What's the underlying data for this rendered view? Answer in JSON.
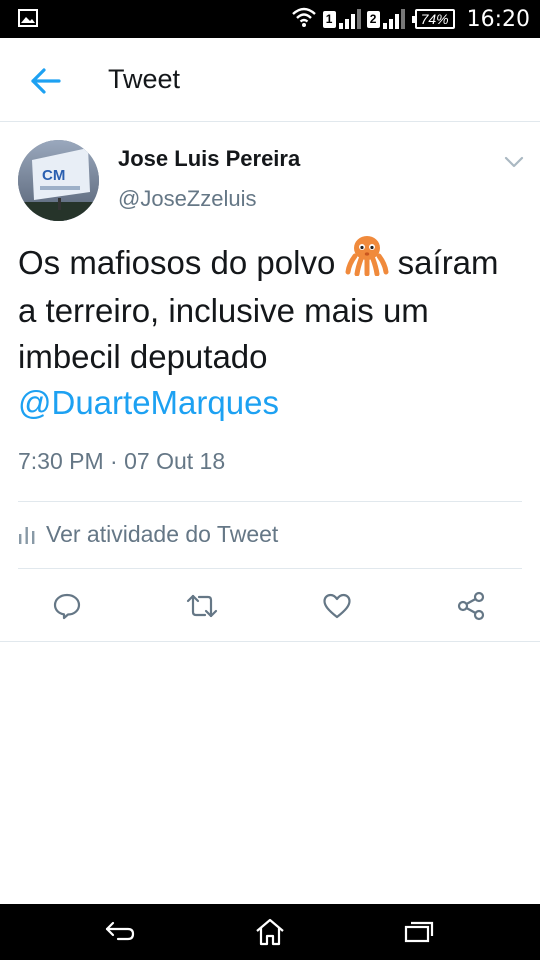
{
  "status_bar": {
    "left_icon": "image-notification-icon",
    "wifi_icon": "wifi-icon",
    "sim1_label": "1",
    "sim2_label": "2",
    "battery": "74%",
    "time": "16:20"
  },
  "header": {
    "back_icon": "arrow-left-icon",
    "title": "Tweet"
  },
  "tweet": {
    "author_name": "Jose Luis Pereira",
    "author_handle": "@JoseZzeluis",
    "text_part1": "Os mafiosos do polvo",
    "emoji": "octopus-emoji",
    "text_part2": "saíram a terreiro, inclusive mais um imbecil deputado",
    "mention": "@DuarteMarques",
    "timestamp": "7:30 PM · 07 Out 18",
    "activity_label": "Ver atividade do Tweet"
  },
  "actions": [
    "reply-icon",
    "retweet-icon",
    "like-icon",
    "share-icon"
  ],
  "nav_bar": [
    "back-nav-icon",
    "home-nav-icon",
    "recents-nav-icon"
  ],
  "colors": {
    "accent": "#1da1f2",
    "text": "#14171a",
    "secondary": "#657786",
    "divider": "#e1e8ed"
  }
}
